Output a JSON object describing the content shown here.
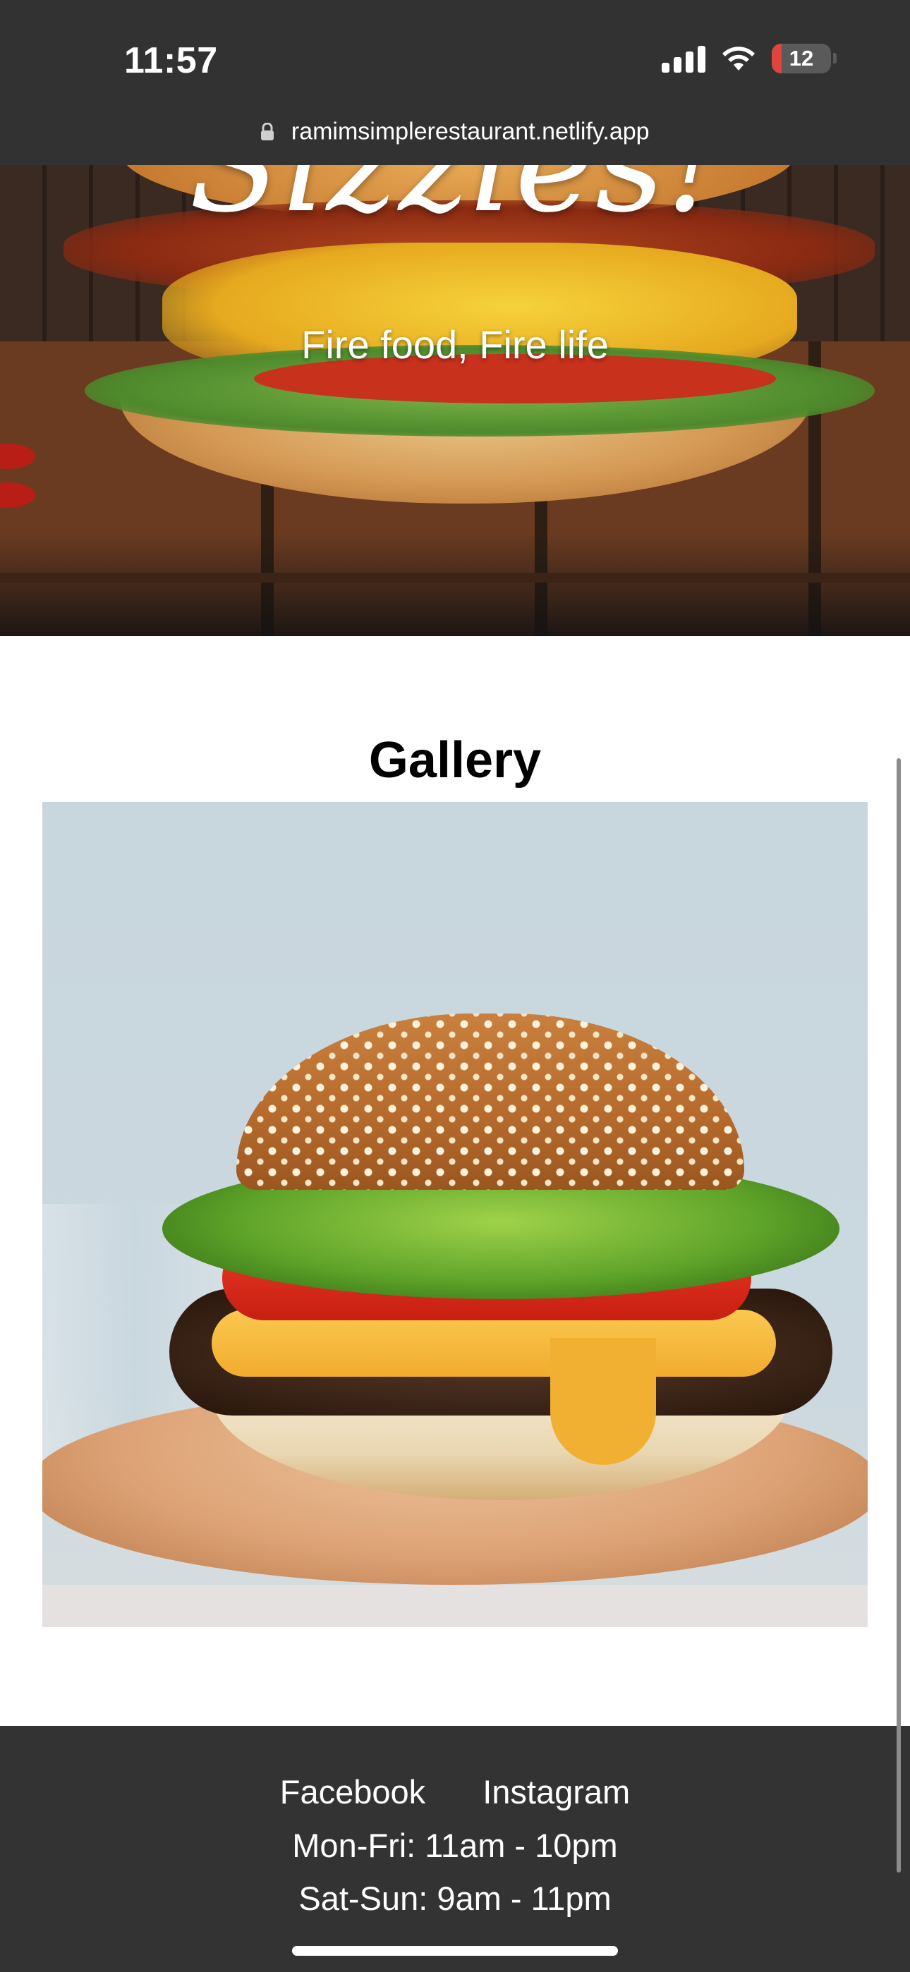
{
  "status_bar": {
    "time": "11:57",
    "battery_level": "12",
    "battery_color": "#e0443e"
  },
  "browser": {
    "url": "ramimsimplerestaurant.netlify.app",
    "icon": "lock-icon"
  },
  "hero": {
    "title": "Sizzles!",
    "subtitle": "Fire food, Fire life"
  },
  "gallery": {
    "heading": "Gallery",
    "image_icon": "cheeseburger-photo"
  },
  "footer": {
    "links": [
      "Facebook",
      "Instagram"
    ],
    "hours_weekday": "Mon-Fri: 11am - 10pm",
    "hours_weekend": "Sat-Sun: 9am - 11pm",
    "background": "#333333"
  }
}
